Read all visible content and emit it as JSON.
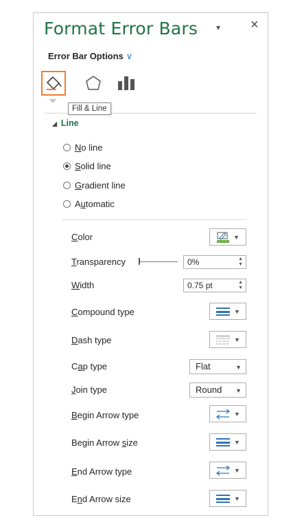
{
  "panel": {
    "title": "Format Error Bars",
    "caret": "▾",
    "close": "×",
    "options_label": "Error Bar Options",
    "options_chevron": "∨"
  },
  "tooltip": "Fill & Line",
  "section": {
    "title": "Line",
    "expanded": true
  },
  "line_options": {
    "selected": "Solid line",
    "items": [
      {
        "pre": "",
        "u": "N",
        "post": "o line"
      },
      {
        "pre": "",
        "u": "S",
        "post": "olid line"
      },
      {
        "pre": "",
        "u": "G",
        "post": "radient line"
      },
      {
        "pre": "A",
        "u": "u",
        "post": "tomatic"
      }
    ]
  },
  "props": {
    "color": {
      "pre": "",
      "u": "C",
      "post": "olor",
      "swatch": "#70ad47"
    },
    "transparency": {
      "pre": "",
      "u": "T",
      "post": "ransparency",
      "value": "0%"
    },
    "width": {
      "pre": "",
      "u": "W",
      "post": "idth",
      "value": "0.75 pt"
    },
    "compound": {
      "pre": "",
      "u": "C",
      "post": "ompound type"
    },
    "dash": {
      "pre": "",
      "u": "D",
      "post": "ash type"
    },
    "cap": {
      "pre": "C",
      "u": "a",
      "post": "p type",
      "value": "Flat"
    },
    "join": {
      "pre": "",
      "u": "J",
      "post": "oin type",
      "value": "Round"
    },
    "begin_type": {
      "pre": "",
      "u": "B",
      "post": "egin Arrow type"
    },
    "begin_size": {
      "pre": "Begin Arrow ",
      "u": "s",
      "post": "ize"
    },
    "end_type": {
      "pre": "",
      "u": "E",
      "post": "nd Arrow type"
    },
    "end_size": {
      "pre": "E",
      "u": "n",
      "post": "d Arrow size"
    }
  },
  "icons": {
    "fill_line": "paint-bucket-icon",
    "effects": "pentagon-icon",
    "size": "bar-chart-icon",
    "accent": "#ed7d31",
    "line_blue": "#2e75b6"
  }
}
